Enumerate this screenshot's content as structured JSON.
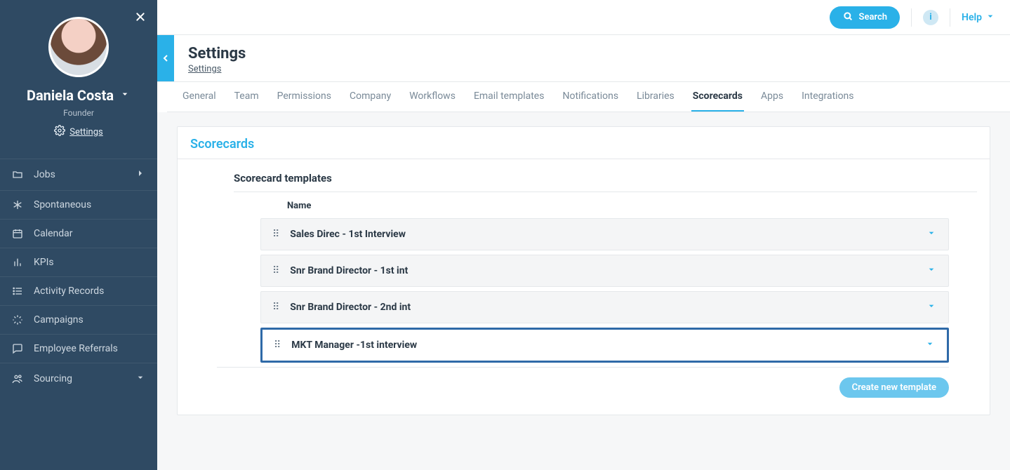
{
  "topbar": {
    "search_label": "Search",
    "help_label": "Help"
  },
  "profile": {
    "name": "Daniela Costa",
    "role": "Founder",
    "settings_label": "Settings"
  },
  "sidebar": {
    "items": [
      {
        "label": "Jobs",
        "has_sub": true
      },
      {
        "label": "Spontaneous",
        "has_sub": false
      },
      {
        "label": "Calendar",
        "has_sub": false
      },
      {
        "label": "KPIs",
        "has_sub": false
      },
      {
        "label": "Activity Records",
        "has_sub": false
      },
      {
        "label": "Campaigns",
        "has_sub": false
      },
      {
        "label": "Employee Referrals",
        "has_sub": false
      },
      {
        "label": "Sourcing",
        "has_sub": true
      }
    ]
  },
  "page": {
    "title": "Settings",
    "breadcrumb": "Settings"
  },
  "tabs": [
    {
      "label": "General",
      "active": false
    },
    {
      "label": "Team",
      "active": false
    },
    {
      "label": "Permissions",
      "active": false
    },
    {
      "label": "Company",
      "active": false
    },
    {
      "label": "Workflows",
      "active": false
    },
    {
      "label": "Email templates",
      "active": false
    },
    {
      "label": "Notifications",
      "active": false
    },
    {
      "label": "Libraries",
      "active": false
    },
    {
      "label": "Scorecards",
      "active": true
    },
    {
      "label": "Apps",
      "active": false
    },
    {
      "label": "Integrations",
      "active": false
    }
  ],
  "scorecards": {
    "panel_title": "Scorecards",
    "section_title": "Scorecard templates",
    "column_name": "Name",
    "templates": [
      {
        "name": "Sales Direc - 1st Interview",
        "highlight": false
      },
      {
        "name": "Snr Brand Director - 1st int",
        "highlight": false
      },
      {
        "name": "Snr Brand Director - 2nd int",
        "highlight": false
      },
      {
        "name": "MKT Manager -1st interview",
        "highlight": true
      }
    ],
    "create_label": "Create new template"
  }
}
